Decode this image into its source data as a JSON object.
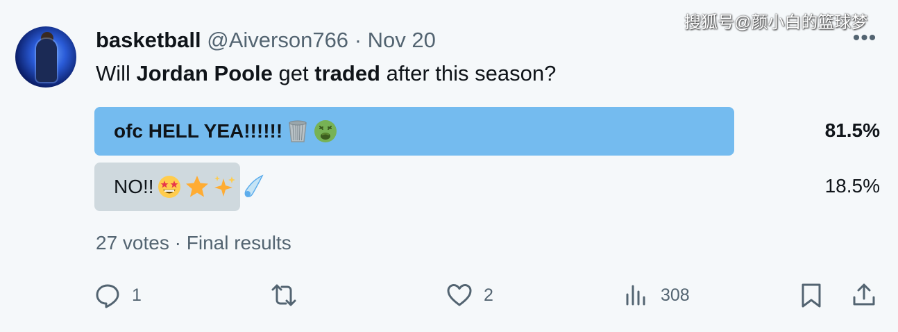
{
  "watermark": "搜狐号@颜小白的篮球梦",
  "tweet": {
    "display_name": "basketball",
    "handle": "@Aiverson766",
    "separator": "·",
    "date": "Nov 20",
    "more_label": "•••",
    "text_parts": [
      {
        "text": "Will ",
        "bold": false
      },
      {
        "text": "Jordan Poole",
        "bold": true
      },
      {
        "text": " get ",
        "bold": false
      },
      {
        "text": "traded",
        "bold": true
      },
      {
        "text": " after this season?",
        "bold": false
      }
    ]
  },
  "poll": {
    "options": [
      {
        "label": "ofc HELL YEA!!!!!!",
        "emojis": [
          "wastebasket-emoji",
          "nauseated-face-emoji"
        ],
        "percent_text": "81.5%",
        "percent": 81.5,
        "winner": true
      },
      {
        "label": "NO!!",
        "emojis": [
          "star-struck-emoji",
          "star-emoji",
          "sparkles-emoji",
          "comet-emoji"
        ],
        "percent_text": "18.5%",
        "percent": 18.5,
        "winner": false
      }
    ],
    "votes": "27 votes",
    "separator": "·",
    "status": "Final results",
    "colors": {
      "winner_bar": "#74bbef",
      "other_bar": "#cfd9de"
    }
  },
  "actions": {
    "reply_count": "1",
    "retweet_count": "",
    "like_count": "2",
    "views_count": "308"
  }
}
